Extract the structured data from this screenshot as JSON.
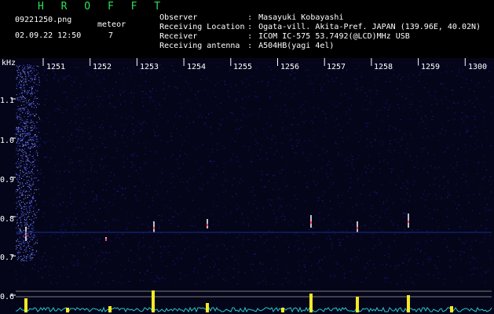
{
  "app": {
    "title": "H R O F F T"
  },
  "file": {
    "name": "09221250.png",
    "datetime": "02.09.22 12:50"
  },
  "meteor": {
    "label": "meteor",
    "count": "7"
  },
  "station": {
    "rows": [
      {
        "label": "Observer",
        "sep": ":",
        "value": "Masayuki Kobayashi"
      },
      {
        "label": "Receiving Location",
        "sep": ":",
        "value": "Ogata-vill. Akita-Pref. JAPAN (139.96E, 40.02N)"
      },
      {
        "label": "Receiver",
        "sep": ":",
        "value": "ICOM IC-575 53.7492(@LCD)MHz USB"
      },
      {
        "label": "Receiving antenna",
        "sep": ":",
        "value": "A504HB(yagi 4el)"
      }
    ]
  },
  "axis": {
    "unit": "kHz",
    "x_ticks": [
      "1251",
      "1252",
      "1253",
      "1254",
      "1255",
      "1256",
      "1257",
      "1258",
      "1259",
      "1300"
    ],
    "y_ticks": [
      "1.1",
      "1.0",
      "0.9",
      "0.8",
      "0.7",
      "0.6"
    ]
  },
  "colors": {
    "logo": "#2ee05a",
    "spectrum_bg": "#05051a",
    "echo": "#f4e826",
    "baseline": "#28c8c8"
  }
}
